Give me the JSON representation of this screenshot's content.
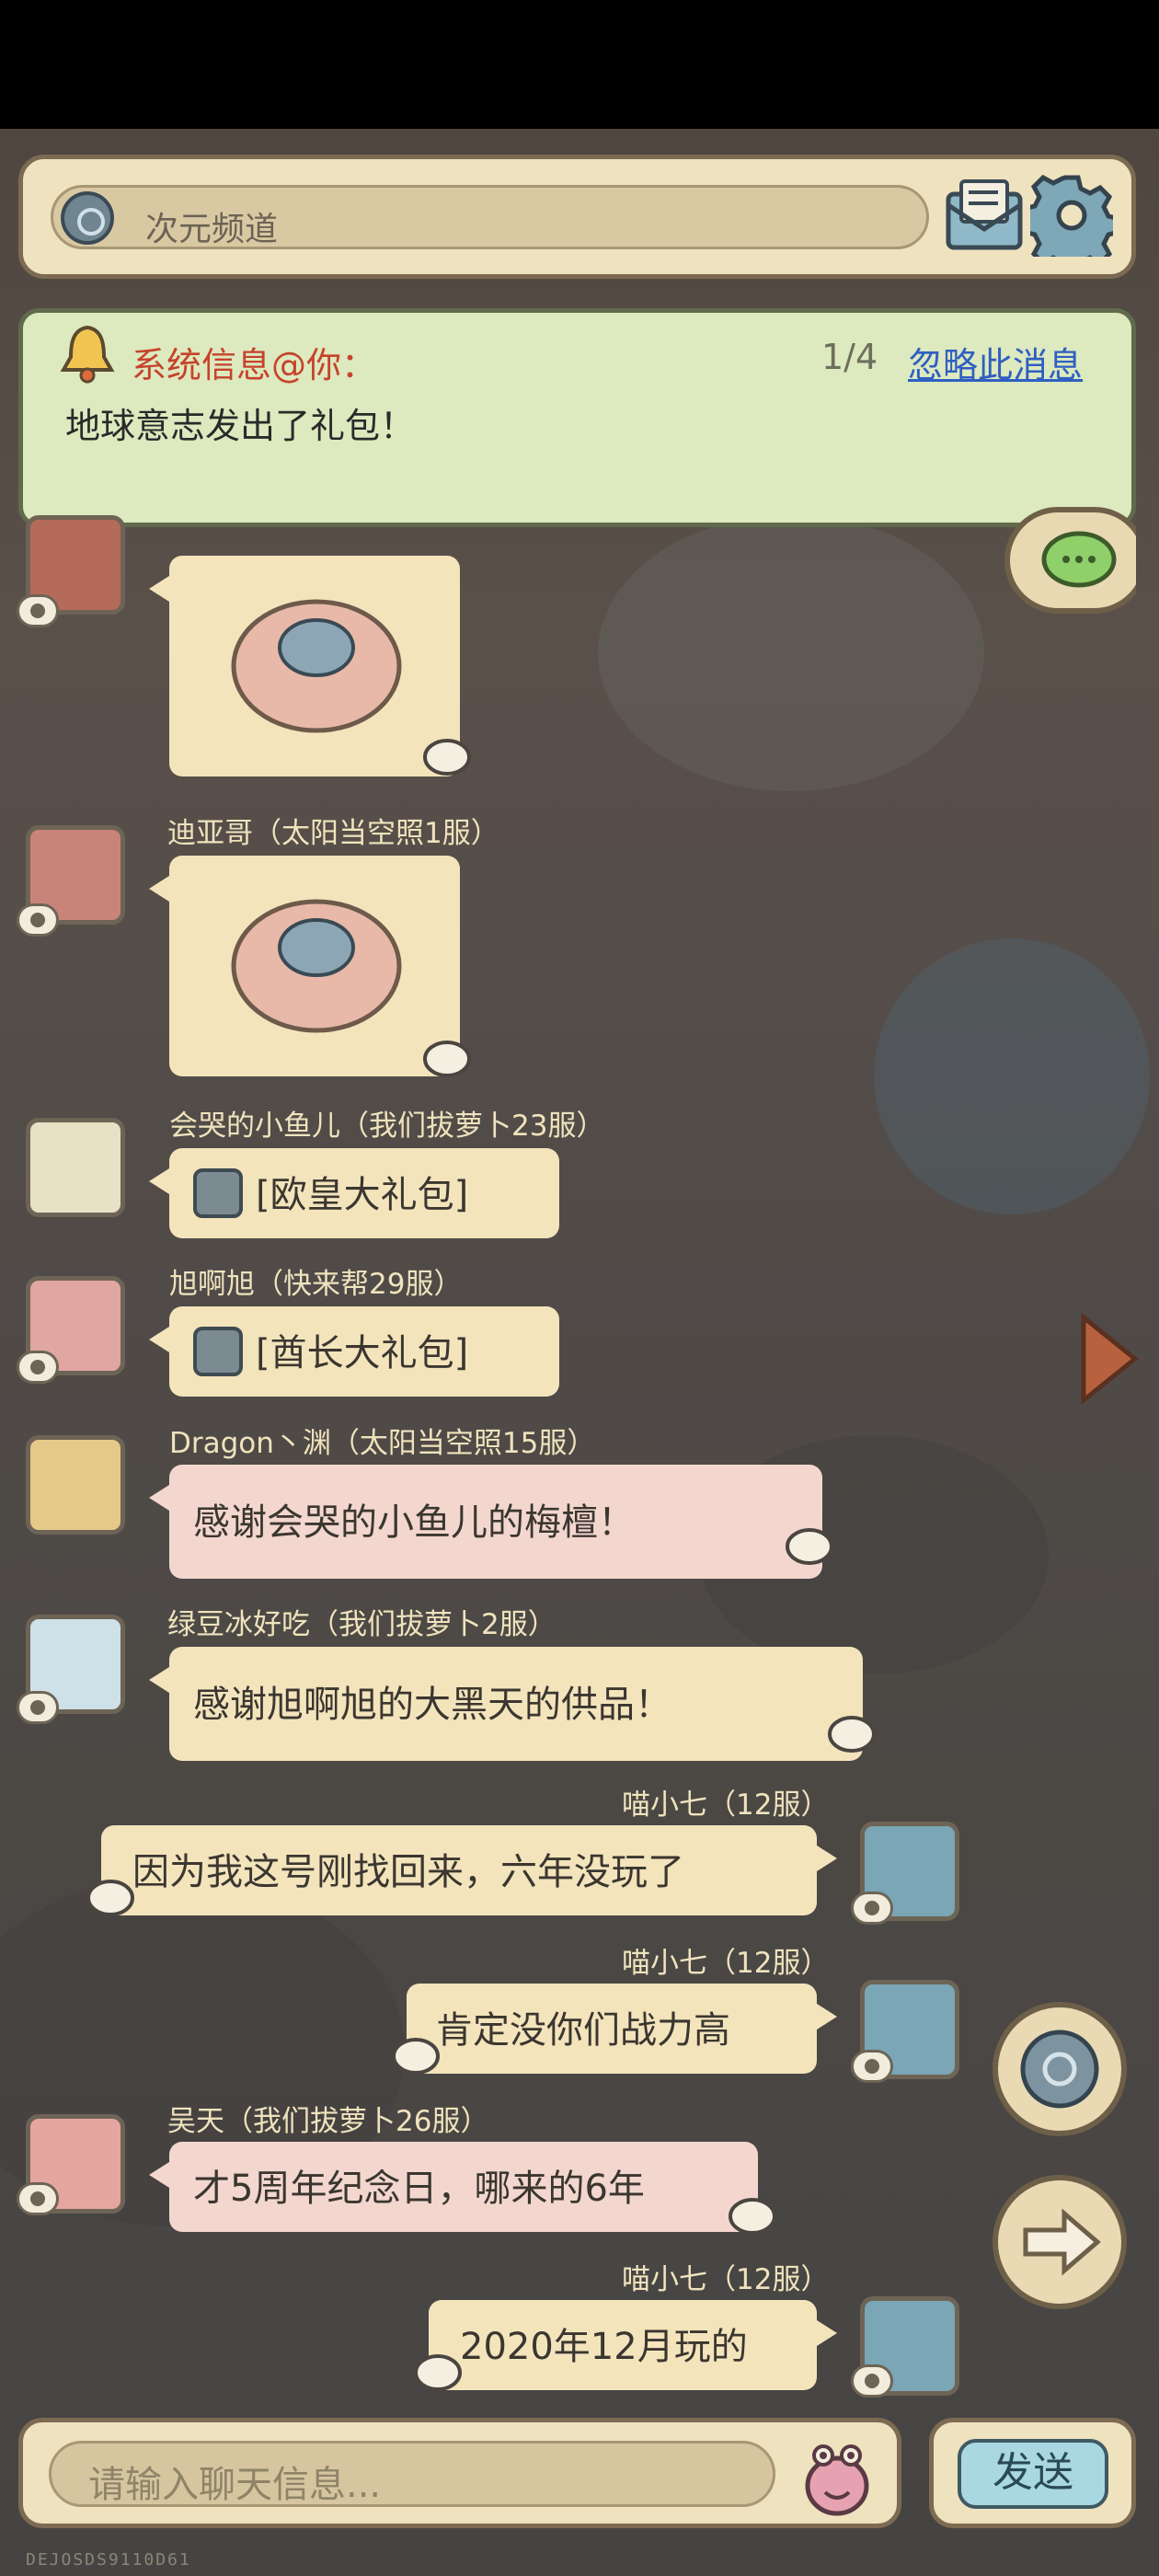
{
  "channel": {
    "label": "次元频道"
  },
  "notice": {
    "title": "系统信息@你：",
    "count": "1/4",
    "ignore": "忽略此消息",
    "body": "地球意志发出了礼包！"
  },
  "messages": [
    {
      "name": "迪亚哥（太阳当空照1服）",
      "type": "sticker"
    },
    {
      "name": "会哭的小鱼儿（我们拔萝卜23服）",
      "text": "[欧皇大礼包]"
    },
    {
      "name": "旭啊旭（快来帮29服）",
      "text": "[酋长大礼包]"
    },
    {
      "name": "Dragon丶渊（太阳当空照15服）",
      "text": "感谢会哭的小鱼儿的梅檀！"
    },
    {
      "name": "绿豆冰好吃（我们拔萝卜2服）",
      "text": "感谢旭啊旭的大黑天的供品！"
    },
    {
      "name": "喵小七（12服）",
      "text": "因为我这号刚找回来，六年没玩了"
    },
    {
      "name": "喵小七（12服）",
      "text": "肯定没你们战力高"
    },
    {
      "name": "吴天（我们拔萝卜26服）",
      "text": "才5周年纪念日，哪来的6年"
    },
    {
      "name": "喵小七（12服）",
      "text": "2020年12月玩的"
    }
  ],
  "input": {
    "placeholder": "请输入聊天信息..."
  },
  "send": {
    "label": "发送"
  },
  "footer": {
    "id": "DEJOSDS9110D61"
  },
  "icons": [
    "channel-icon",
    "mail-icon",
    "gear-icon",
    "bell-icon",
    "chat-icon",
    "arrow-icon",
    "emoji-icon"
  ],
  "colors": {
    "panel": "#efe2bf",
    "notice_bg": "#dde9be",
    "notice_title": "#c5432c",
    "link": "#2e5fc2",
    "send_bg": "#a9d8e2"
  }
}
